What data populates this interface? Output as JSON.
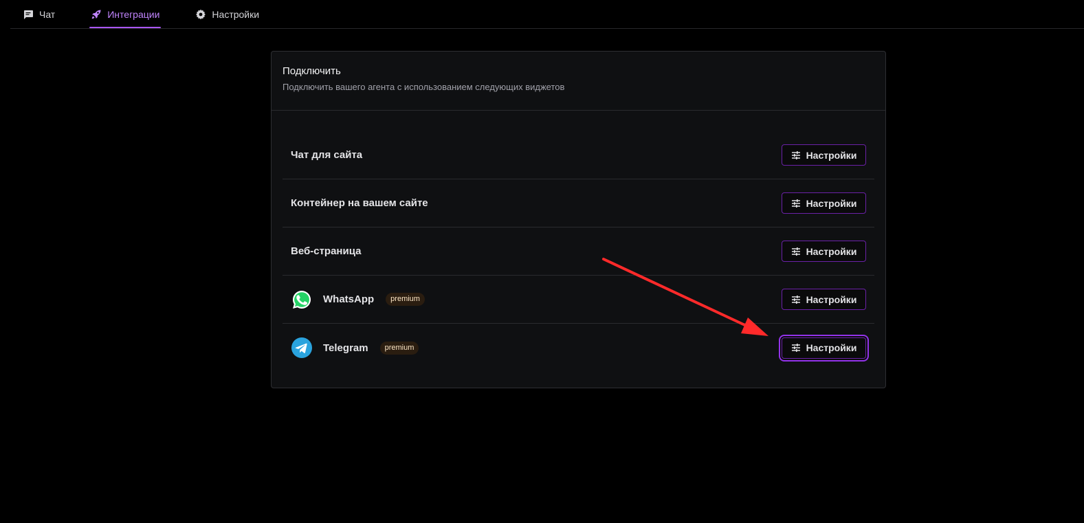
{
  "nav": {
    "tabs": [
      {
        "label": "Чат",
        "icon": "chat-icon",
        "active": false
      },
      {
        "label": "Интеграции",
        "icon": "rocket-icon",
        "active": true
      },
      {
        "label": "Настройки",
        "icon": "gear-icon",
        "active": false
      }
    ]
  },
  "card": {
    "title": "Подключить",
    "subtitle": "Подключить вашего агента с использованием следующих виджетов"
  },
  "integrations": [
    {
      "label": "Чат для сайта",
      "button": "Настройки"
    },
    {
      "label": "Контейнер на вашем сайте",
      "button": "Настройки"
    },
    {
      "label": "Веб-страница",
      "button": "Настройки"
    },
    {
      "label": "WhatsApp",
      "badge": "premium",
      "icon": "whatsapp-icon",
      "button": "Настройки"
    },
    {
      "label": "Telegram",
      "badge": "premium",
      "icon": "telegram-icon",
      "button": "Настройки",
      "focused": true
    }
  ],
  "colors": {
    "accent": "#a855f7",
    "button_border": "#6b21a8",
    "badge_bg": "#2a1d10",
    "annotation_arrow": "#ff2a2a",
    "whatsapp": "#25d366",
    "telegram": "#2aa3de"
  }
}
